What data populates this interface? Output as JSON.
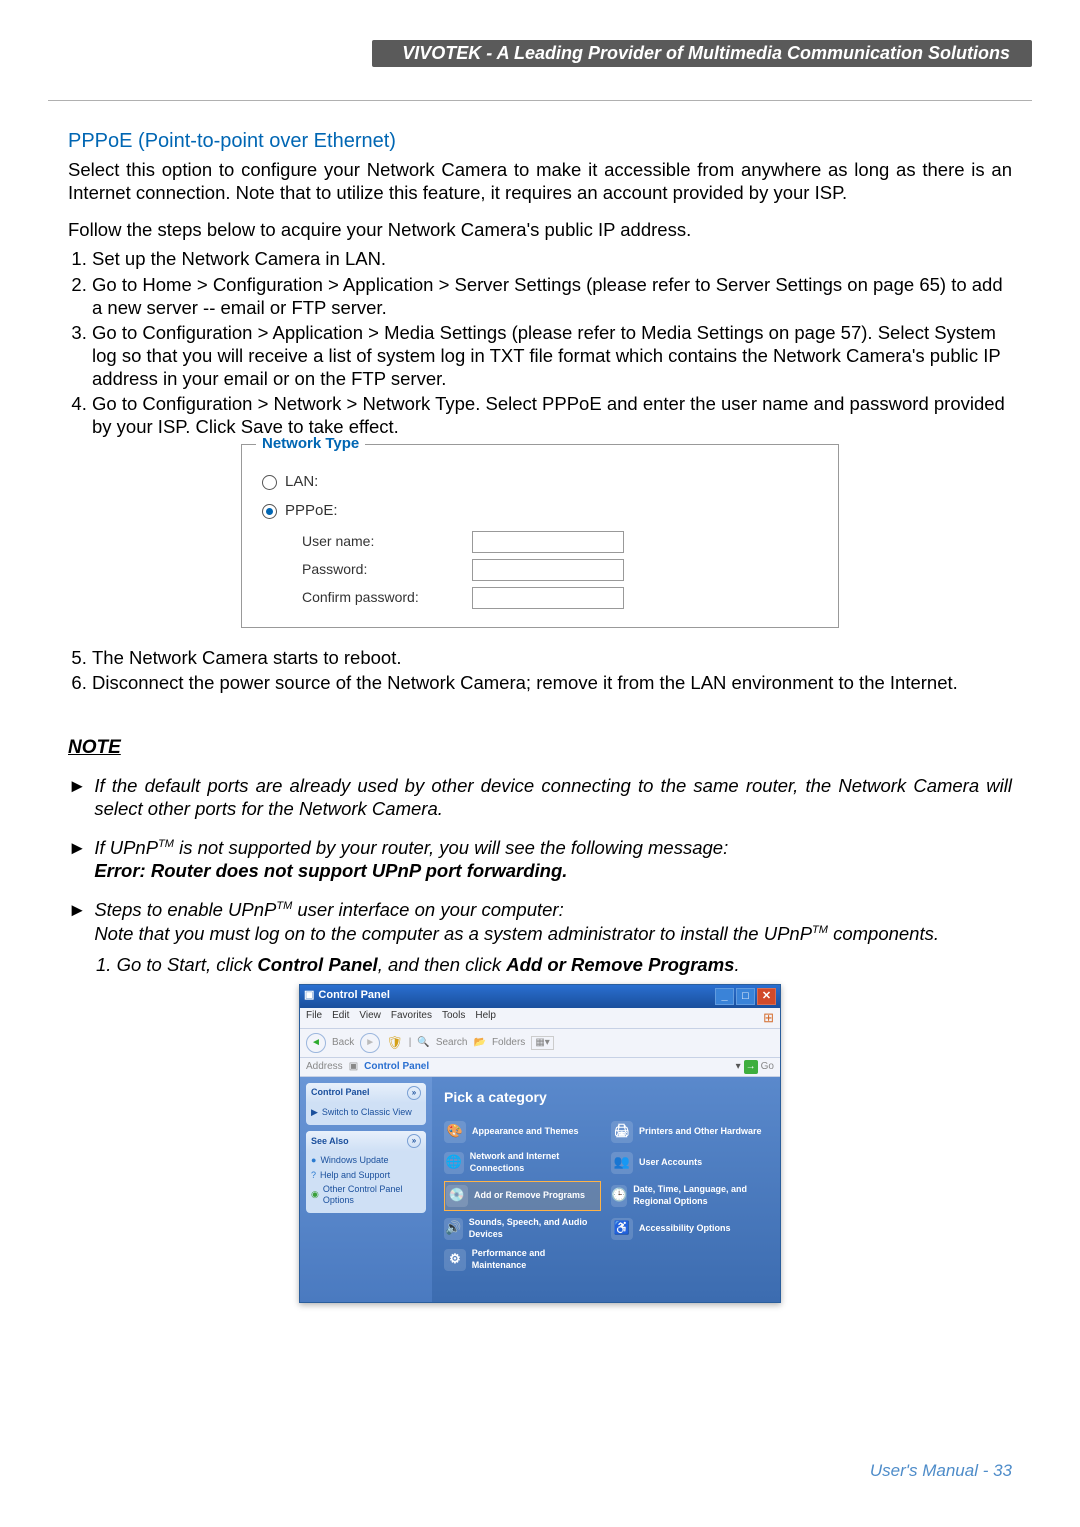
{
  "header": {
    "title": "VIVOTEK - A Leading Provider of Multimedia Communication Solutions"
  },
  "section_title": "PPPoE (Point-to-point over Ethernet)",
  "intro": "Select this option to configure your Network Camera to make it accessible from anywhere as long as there is an Internet connection. Note that to utilize this feature, it requires an account provided by your ISP.",
  "follow_line": "Follow the steps below to acquire your Network Camera's public IP address.",
  "steps_a": [
    "Set up the Network Camera in LAN.",
    "Go to Home > Configuration > Application > Server Settings (please refer to Server Settings on page 65) to add a new server -- email or FTP server.",
    "Go to Configuration > Application > Media Settings (please refer to Media Settings on page 57). Select System log so that you will receive a list of system log in TXT file format which contains the Network Camera's public IP address in your email or on the FTP server.",
    "Go to Configuration > Network > Network Type. Select PPPoE and enter the user name and password provided by your ISP. Click Save to take effect."
  ],
  "netbox": {
    "legend": "Network Type",
    "lan": "LAN:",
    "pppoe": "PPPoE:",
    "username_label": "User name:",
    "password_label": "Password:",
    "confirm_label": "Confirm password:"
  },
  "steps_b_start": 5,
  "steps_b": [
    "The Network Camera starts to reboot.",
    "Disconnect the power source of the Network Camera; remove it from the LAN environment to the Internet."
  ],
  "note_heading": "NOTE",
  "notes": {
    "n1": "If the default ports are already used by other device connecting to the same router, the Network Camera will select other ports for the Network Camera.",
    "n2_a": "If UPnP",
    "n2_b": " is not supported by your router, you will see the following message:",
    "n2_err": "Error: Router does not support UPnP port forwarding.",
    "n3_a": "Steps to enable UPnP",
    "n3_b": " user interface on your computer:",
    "n3_c_a": "Note that you must log on to the computer as a system administrator to install the UPnP",
    "n3_c_b": " components.",
    "n3_step1_a": "1. Go to Start, click ",
    "n3_step1_b": "Control Panel",
    "n3_step1_c": ", and then click ",
    "n3_step1_d": "Add or Remove Programs",
    "n3_step1_e": "."
  },
  "cp": {
    "title": "Control Panel",
    "menu": [
      "File",
      "Edit",
      "View",
      "Favorites",
      "Tools",
      "Help"
    ],
    "toolbar": {
      "back": "Back",
      "search": "Search",
      "folders": "Folders"
    },
    "address_label": "Address",
    "address_value": "Control Panel",
    "go": "Go",
    "side_cp": "Control Panel",
    "side_switch": "Switch to Classic View",
    "see_also": "See Also",
    "see_items": [
      "Windows Update",
      "Help and Support",
      "Other Control Panel Options"
    ],
    "pick": "Pick a category",
    "cats": [
      "Appearance and Themes",
      "Printers and Other Hardware",
      "Network and Internet Connections",
      "User Accounts",
      "Add or Remove Programs",
      "Date, Time, Language, and Regional Options",
      "Sounds, Speech, and Audio Devices",
      "Accessibility Options",
      "Performance and Maintenance"
    ]
  },
  "footer": "User's Manual - 33"
}
